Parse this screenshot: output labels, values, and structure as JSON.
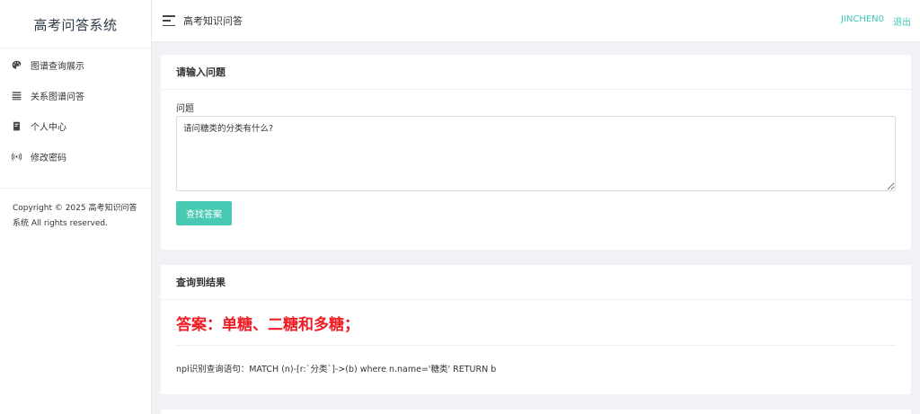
{
  "sidebar": {
    "brand": "高考问答系统",
    "items": [
      {
        "label": "图谱查询展示",
        "icon": "palette-icon"
      },
      {
        "label": "关系图谱问答",
        "icon": "list-icon"
      },
      {
        "label": "个人中心",
        "icon": "book-icon"
      },
      {
        "label": "修改密码",
        "icon": "broadcast-icon"
      }
    ],
    "copyright": "Copyright © 2025 高考知识问答系统 All rights reserved."
  },
  "topbar": {
    "title": "高考知识问答",
    "username": "JINCHEN0",
    "logout": "退出"
  },
  "question_card": {
    "header": "请输入问题",
    "field_label": "问题",
    "question_value": "请问糖类的分类有什么?",
    "button_label": "查找答案"
  },
  "result_card": {
    "header": "查询到结果",
    "answer": "答案：单糖、二糖和多糖；",
    "query": "npl识别查询语句：MATCH (n)-[r:`分类`]->(b) where n.name='糖类' RETURN b"
  },
  "colors": {
    "accent": "#3ec5b6",
    "button": "#48c9b4",
    "answer": "#ee1c24"
  }
}
